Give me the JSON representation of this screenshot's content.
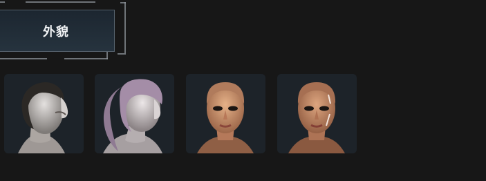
{
  "tab": {
    "label": "外貌"
  },
  "cards": [
    {
      "name": "short-dark-hair-side-profile",
      "icon": "head-side-icon",
      "skin_color": "#b9b6b3",
      "hair_color": "#2b2825"
    },
    {
      "name": "lavender-ponytail-side-profile",
      "icon": "ponytail-head-icon",
      "skin_color": "#c5c0c1",
      "hair_color": "#a48da7"
    },
    {
      "name": "bald-face-front-view",
      "icon": "face-front-icon",
      "skin_color": "#d39c75",
      "hair_color": "#b07b5c"
    },
    {
      "name": "bald-face-front-view-markings",
      "icon": "face-front-markings-icon",
      "skin_color": "#c8916d",
      "hair_color": "#a66f52"
    }
  ]
}
